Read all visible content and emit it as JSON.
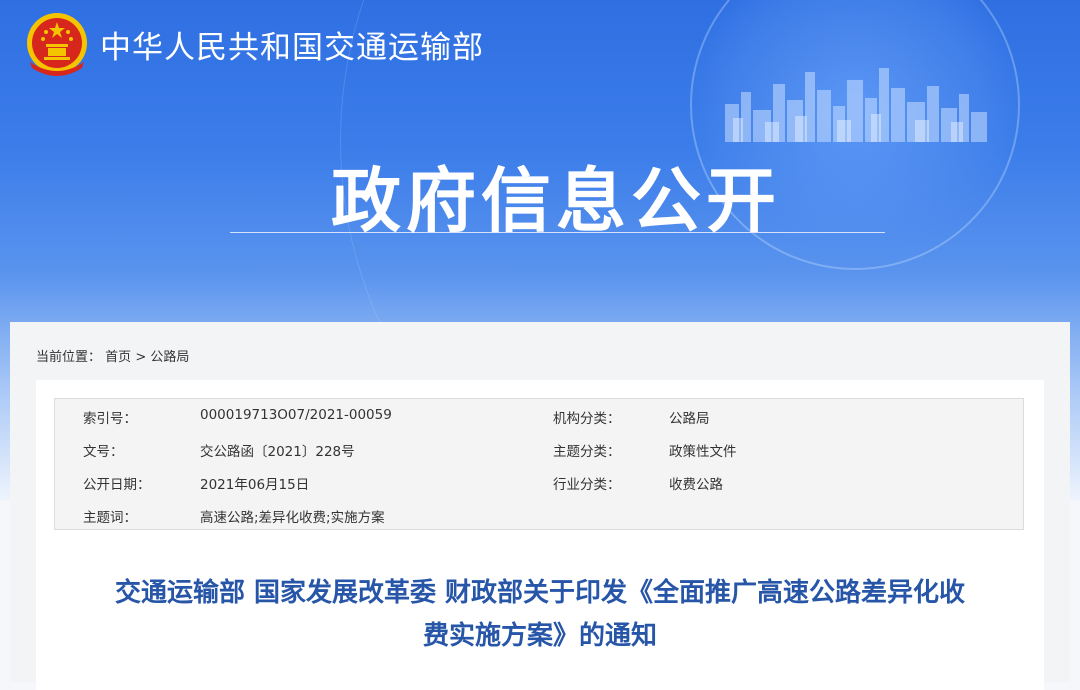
{
  "header": {
    "site_name": "中华人民共和国交通运输部",
    "hero_title": "政府信息公开"
  },
  "breadcrumb": {
    "prefix": "当前位置：",
    "home": "首页",
    "separator": ">",
    "current": "公路局"
  },
  "meta": {
    "index_label": "索引号：",
    "index_value": "000019713O07/2021-00059",
    "org_label": "机构分类：",
    "org_value": "公路局",
    "doc_no_label": "文号：",
    "doc_no_value": "交公路函〔2021〕228号",
    "topic_label": "主题分类：",
    "topic_value": "政策性文件",
    "date_label": "公开日期：",
    "date_value": "2021年06月15日",
    "industry_label": "行业分类：",
    "industry_value": "收费公路",
    "keywords_label": "主题词：",
    "keywords_value": "高速公路;差异化收费;实施方案"
  },
  "document": {
    "title_line1": "交通运输部 国家发展改革委 财政部关于印发《全面推广高速公路差异化收",
    "title_line2": "费实施方案》的通知"
  },
  "colors": {
    "banner_blue": "#3c7dea",
    "title_blue": "#2756a8",
    "emblem_red": "#d7261c",
    "emblem_gold": "#f5c400"
  },
  "icons": {
    "emblem": "national-emblem-icon",
    "skyline": "city-skyline-illustration"
  }
}
